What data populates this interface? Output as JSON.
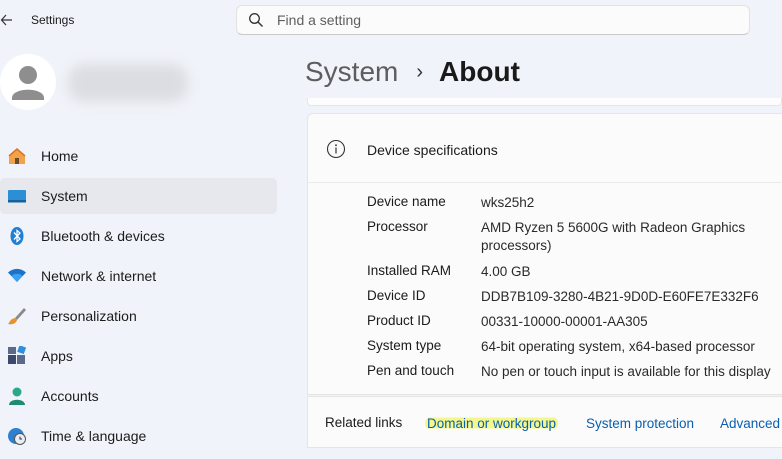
{
  "window": {
    "title": "Settings"
  },
  "search": {
    "placeholder": "Find a setting"
  },
  "sidebar": {
    "items": [
      {
        "label": "Home",
        "icon": "home-icon"
      },
      {
        "label": "System",
        "icon": "monitor-icon",
        "active": true
      },
      {
        "label": "Bluetooth & devices",
        "icon": "bluetooth-icon"
      },
      {
        "label": "Network & internet",
        "icon": "wifi-icon"
      },
      {
        "label": "Personalization",
        "icon": "brush-icon"
      },
      {
        "label": "Apps",
        "icon": "apps-icon"
      },
      {
        "label": "Accounts",
        "icon": "person-icon"
      },
      {
        "label": "Time & language",
        "icon": "globe-clock-icon"
      }
    ]
  },
  "breadcrumb": {
    "parent": "System",
    "separator": "›",
    "current": "About"
  },
  "specs": {
    "title": "Device specifications",
    "rows": [
      {
        "key": "Device name",
        "value": "wks25h2"
      },
      {
        "key": "Processor",
        "value": "AMD Ryzen 5 5600G with Radeon Graphics processors)"
      },
      {
        "key": "Installed RAM",
        "value": "4.00 GB"
      },
      {
        "key": "Device ID",
        "value": "DDB7B109-3280-4B21-9D0D-E60FE7E332F6"
      },
      {
        "key": "Product ID",
        "value": "00331-10000-00001-AA305"
      },
      {
        "key": "System type",
        "value": "64-bit operating system, x64-based processor"
      },
      {
        "key": "Pen and touch",
        "value": "No pen or touch input is available for this display"
      }
    ]
  },
  "related": {
    "label": "Related links",
    "links": [
      "Domain or workgroup",
      "System protection",
      "Advanced"
    ]
  },
  "colors": {
    "accent": "#0a5fb0",
    "highlight": "#f4f78a",
    "active_nav": "#e6e8ee"
  }
}
